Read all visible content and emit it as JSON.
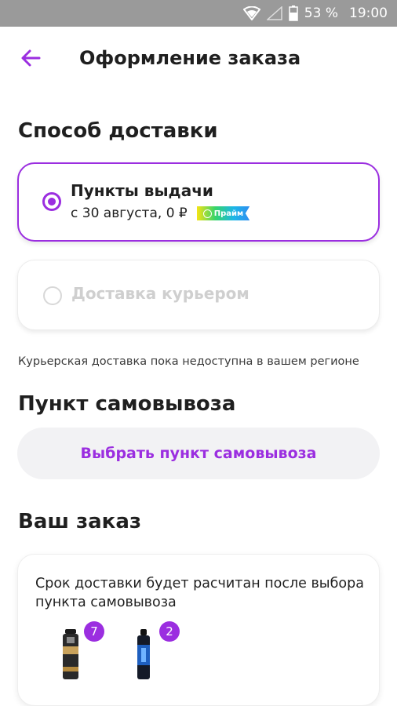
{
  "status_bar": {
    "battery_percent": "53 %",
    "time": "19:00"
  },
  "header": {
    "title": "Оформление заказа"
  },
  "delivery": {
    "heading": "Способ доставки",
    "pickup_option": {
      "title": "Пункты выдачи",
      "subtitle": "с 30 августа, 0 ₽",
      "badge": "Прайм"
    },
    "courier_option": {
      "title": "Доставка курьером"
    },
    "note": "Курьерская доставка пока недоступна в вашем регионе"
  },
  "pickup_point": {
    "heading": "Пункт самовывоза",
    "button_label": "Выбрать пункт самовывоза"
  },
  "order": {
    "heading": "Ваш заказ",
    "info": "Срок доставки будет расчитан после выбора пункта самовывоза",
    "items": [
      {
        "quantity": "7"
      },
      {
        "quantity": "2"
      }
    ]
  },
  "colors": {
    "accent": "#9b2ee0"
  }
}
